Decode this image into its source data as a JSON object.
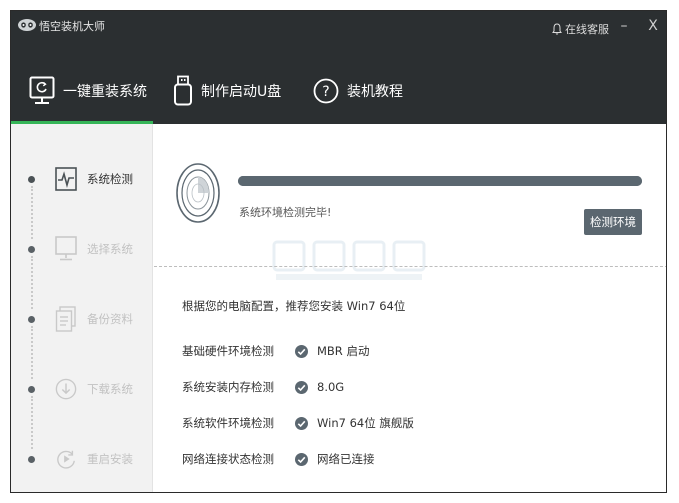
{
  "app": {
    "title": "悟空装机大师"
  },
  "titlebar": {
    "support_label": "在线客服",
    "minimize_symbol": "–",
    "close_symbol": "X"
  },
  "nav": {
    "tabs": [
      {
        "label": "一键重装系统",
        "icon": "monitor-refresh-icon",
        "active": true
      },
      {
        "label": "制作启动U盘",
        "icon": "usb-drive-icon",
        "active": false
      },
      {
        "label": "装机教程",
        "icon": "question-circle-icon",
        "active": false
      }
    ]
  },
  "sidebar": {
    "steps": [
      {
        "label": "系统检测",
        "icon": "pulse-icon",
        "active": true
      },
      {
        "label": "选择系统",
        "icon": "monitor-icon",
        "active": false
      },
      {
        "label": "备份资料",
        "icon": "document-icon",
        "active": false
      },
      {
        "label": "下载系统",
        "icon": "download-icon",
        "active": false
      },
      {
        "label": "重启安装",
        "icon": "restart-icon",
        "active": false
      }
    ]
  },
  "main": {
    "progress_fraction": 1.0,
    "status_text": "系统环境检测完毕!",
    "detect_button_label": "检测环境",
    "summary_text": "根据您的电脑配置，推荐您安装 Win7 64位",
    "checks": [
      {
        "label": "基础硬件环境检测",
        "value": "MBR 启动"
      },
      {
        "label": "系统安装内存检测",
        "value": "8.0G"
      },
      {
        "label": "系统软件环境检测",
        "value": "Win7 64位 旗舰版"
      },
      {
        "label": "网络连接状态检测",
        "value": "网络已连接"
      }
    ]
  },
  "colors": {
    "titlebar_bg": "#2b2f31",
    "accent_green": "#35b558",
    "progress_and_button": "#5b6770",
    "sidebar_bg": "#f2f2f2",
    "inactive_text": "#c2c2c2"
  }
}
